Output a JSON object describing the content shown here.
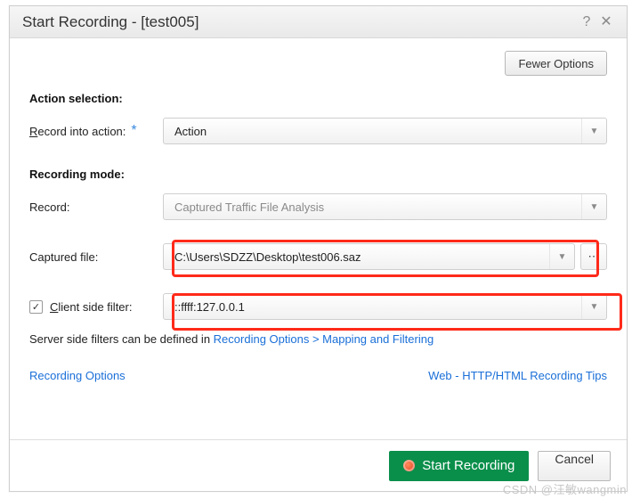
{
  "title": "Start Recording - [test005]",
  "buttons": {
    "fewer_options": "Fewer Options",
    "start_recording": "Start Recording",
    "cancel": "Cancel"
  },
  "sections": {
    "action_selection": "Action selection:",
    "recording_mode": "Recording mode:"
  },
  "labels": {
    "record_into_action_prefix": "R",
    "record_into_action_rest": "ecord into action:",
    "record": "Record:",
    "captured_file": "Captured file:",
    "client_side_filter_prefix": "C",
    "client_side_filter_rest": "lient side filter:"
  },
  "values": {
    "action": "Action",
    "record_mode": "Captured Traffic File Analysis",
    "captured_file": "C:\\Users\\SDZZ\\Desktop\\test006.saz",
    "client_filter": "::ffff:127.0.0.1"
  },
  "note": {
    "prefix": "Server side filters can be defined in ",
    "link": "Recording Options > Mapping and Filtering"
  },
  "links": {
    "recording_options": "Recording Options",
    "web_tips": "Web - HTTP/HTML Recording Tips"
  },
  "browse_glyph": "⋯",
  "checked_glyph": "✓",
  "watermark": "CSDN @汪敏wangmin"
}
